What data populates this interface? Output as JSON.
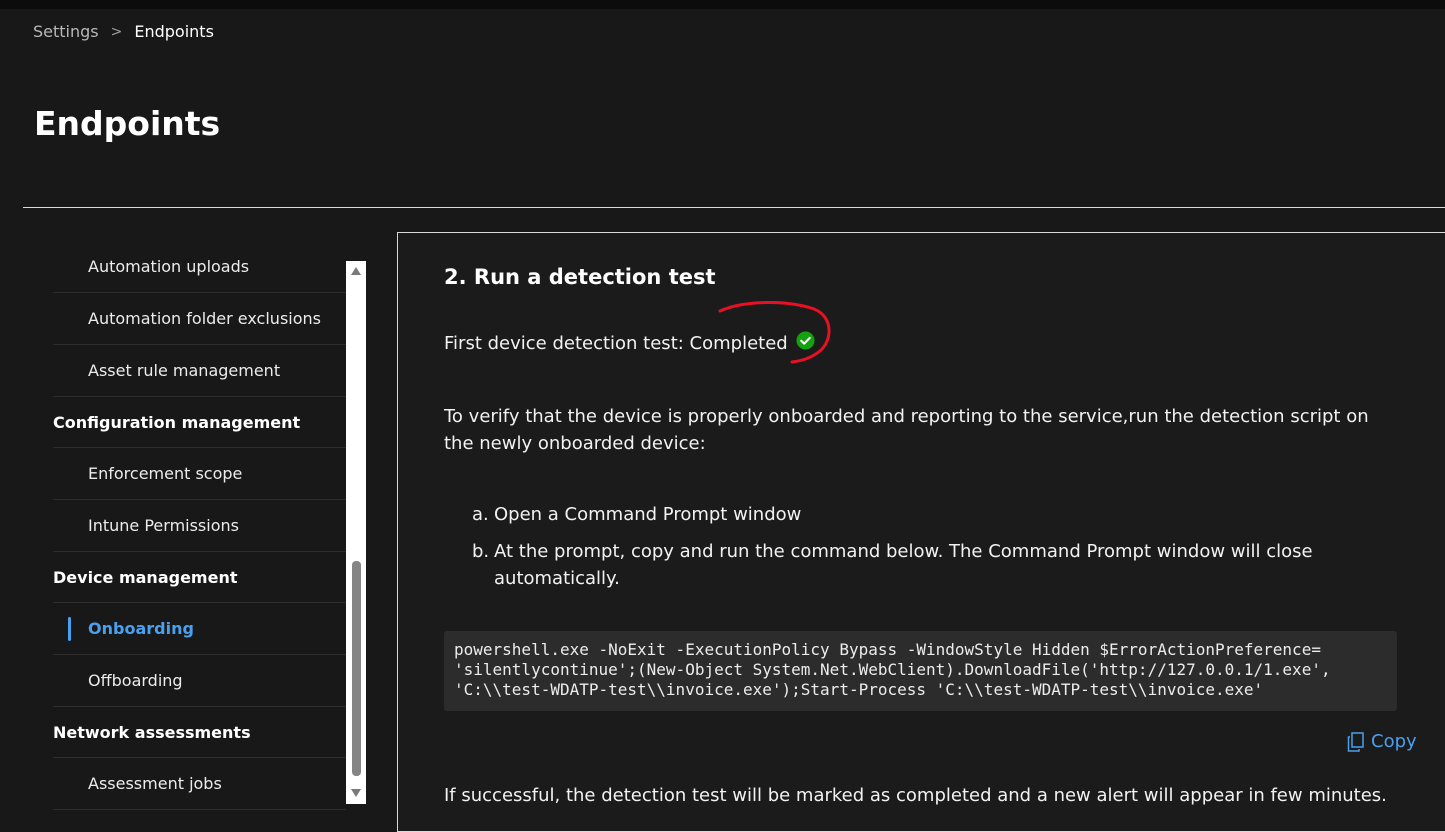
{
  "breadcrumb": {
    "parent": "Settings",
    "separator": ">",
    "current": "Endpoints"
  },
  "page_title": "Endpoints",
  "sidebar": {
    "items": [
      {
        "type": "item",
        "label": "Automation uploads"
      },
      {
        "type": "item",
        "label": "Automation folder exclusions"
      },
      {
        "type": "item",
        "label": "Asset rule management"
      },
      {
        "type": "group",
        "label": "Configuration management"
      },
      {
        "type": "item",
        "label": "Enforcement scope"
      },
      {
        "type": "item",
        "label": "Intune Permissions"
      },
      {
        "type": "group",
        "label": "Device management"
      },
      {
        "type": "item",
        "label": "Onboarding",
        "active": true
      },
      {
        "type": "item",
        "label": "Offboarding"
      },
      {
        "type": "group",
        "label": "Network assessments"
      },
      {
        "type": "item",
        "label": "Assessment jobs"
      }
    ]
  },
  "panel": {
    "title": "2. Run a detection test",
    "status_label": "First device detection test: Completed",
    "status_icon": "check-circle-icon",
    "status_color": "#13a10e",
    "annotation_color": "#e81123",
    "description": "To verify that the device is properly onboarded and reporting to the service,run the detection script on the newly onboarded device:",
    "steps": [
      {
        "marker": "a.",
        "text": "Open a Command Prompt window"
      },
      {
        "marker": "b.",
        "text": "At the prompt, copy and run the command below. The Command Prompt window will close automatically."
      }
    ],
    "command": "powershell.exe -NoExit -ExecutionPolicy Bypass -WindowStyle Hidden $ErrorActionPreference= 'silentlycontinue';(New-Object System.Net.WebClient).DownloadFile('http://127.0.0.1/1.exe', 'C:\\\\test-WDATP-test\\\\invoice.exe');Start-Process 'C:\\\\test-WDATP-test\\\\invoice.exe'",
    "copy_label": "Copy",
    "copy_icon": "copy-icon",
    "footer": "If successful, the detection test will be marked as completed and a new alert will appear in few minutes."
  },
  "colors": {
    "accent": "#4aa0ef",
    "background": "#181818"
  }
}
